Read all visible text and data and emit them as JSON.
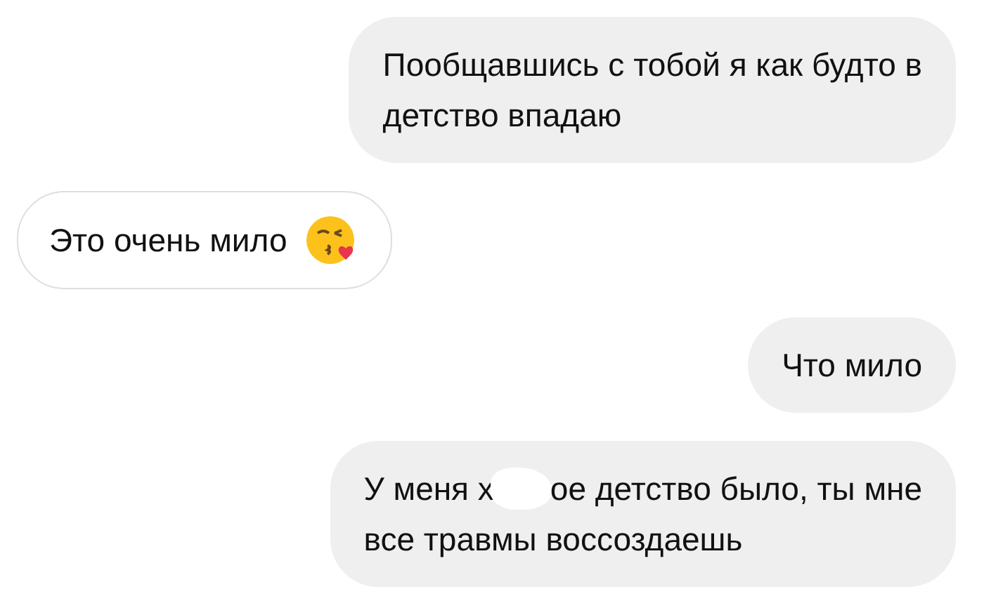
{
  "messages": [
    {
      "kind": "outgoing",
      "lines": [
        [
          {
            "kind": "text",
            "text": "Пообщавшись с тобой я как будто в"
          }
        ],
        [
          {
            "kind": "text",
            "text": "детство впадаю"
          }
        ]
      ]
    },
    {
      "kind": "incoming",
      "emoji": true,
      "lines": [
        [
          {
            "kind": "text",
            "text": "Это очень мило"
          }
        ]
      ]
    },
    {
      "kind": "outgoing",
      "lines": [
        [
          {
            "kind": "text",
            "text": "Что мило"
          }
        ]
      ]
    },
    {
      "kind": "outgoing",
      "lines": [
        [
          {
            "kind": "text",
            "text": "У меня х"
          },
          {
            "kind": "censor"
          },
          {
            "kind": "text",
            "text": "ое детство было, ты мне"
          }
        ],
        [
          {
            "kind": "text",
            "text": "все травмы воссоздаешь"
          }
        ]
      ]
    }
  ]
}
